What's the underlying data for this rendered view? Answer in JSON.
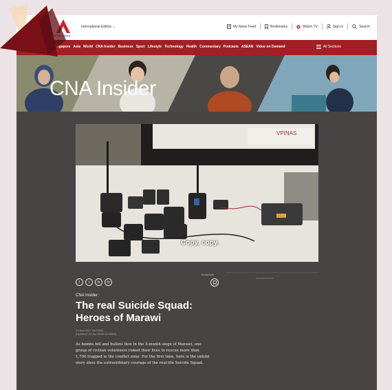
{
  "header": {
    "logo_text": "Channel NewsAsia",
    "edition_label": "International Edition",
    "links": [
      {
        "label": "My News Feed",
        "icon": "newsfeed-icon"
      },
      {
        "label": "Bookmarks",
        "icon": "bookmark-icon"
      },
      {
        "label": "Watch TV",
        "icon": "watch-tv-icon"
      },
      {
        "label": "Sign in",
        "icon": "user-icon"
      },
      {
        "label": "Search",
        "icon": "search-icon"
      }
    ]
  },
  "nav": {
    "items": [
      "Singapore",
      "Asia",
      "World",
      "CNA Insider",
      "Business",
      "Sport",
      "Lifestyle",
      "Technology",
      "Health",
      "Commentary",
      "Podcasts",
      "ASEAN",
      "Video on Demand"
    ],
    "all_sections": "All Sections"
  },
  "banner": {
    "title": "CNA Insider"
  },
  "video": {
    "caption": "Copy, copy."
  },
  "share": {
    "buttons": [
      "f",
      "t",
      "in",
      "✉"
    ]
  },
  "bookmark_label": "Bookmark",
  "sidebar": {
    "ad_label": "Advertisement"
  },
  "article": {
    "category": "CNA Insider:",
    "headline": "The real Suicide Squad: Heroes of Marawi",
    "published": "17 Nov 2017 04:07PM",
    "updated": "(Updated: 29 Jan 2018 10:22AM)",
    "summary": [
      "As bombs fell and bullets flew in the 5-month siege of Marawi, one",
      "group of civilian volunteers risked their lives to rescue more than",
      "1,700 trapped in the conflict zone. For the first time, here is the untold",
      "story abou the extraordinary courage of the real-life Suicide Squad."
    ]
  },
  "colors": {
    "brand_red": "#a31f25",
    "page_background": "#474443",
    "outer_background": "#ece3e6"
  }
}
